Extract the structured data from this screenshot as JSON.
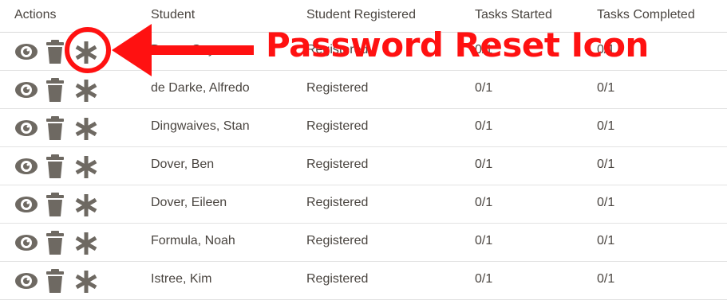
{
  "table": {
    "headers": {
      "actions": "Actions",
      "student": "Student",
      "registered": "Student Registered",
      "started": "Tasks Started",
      "completed": "Tasks Completed"
    },
    "rows": [
      {
        "student": "Dover, Gaye",
        "registered": "Registered",
        "started": "0/1",
        "completed": "0/1"
      },
      {
        "student": "de Darke, Alfredo",
        "registered": "Registered",
        "started": "0/1",
        "completed": "0/1"
      },
      {
        "student": "Dingwaives, Stan",
        "registered": "Registered",
        "started": "0/1",
        "completed": "0/1"
      },
      {
        "student": "Dover, Ben",
        "registered": "Registered",
        "started": "0/1",
        "completed": "0/1"
      },
      {
        "student": "Dover, Eileen",
        "registered": "Registered",
        "started": "0/1",
        "completed": "0/1"
      },
      {
        "student": "Formula, Noah",
        "registered": "Registered",
        "started": "0/1",
        "completed": "0/1"
      },
      {
        "student": "Istree, Kim",
        "registered": "Registered",
        "started": "0/1",
        "completed": "0/1"
      }
    ],
    "icons": [
      "view-icon",
      "delete-icon",
      "password-reset-icon"
    ]
  },
  "annotation": {
    "label": "Password Reset Icon",
    "color": "#ff1111"
  },
  "colors": {
    "icon": "#6e6962",
    "text": "#4a4540",
    "divider": "#e2e2e2"
  }
}
